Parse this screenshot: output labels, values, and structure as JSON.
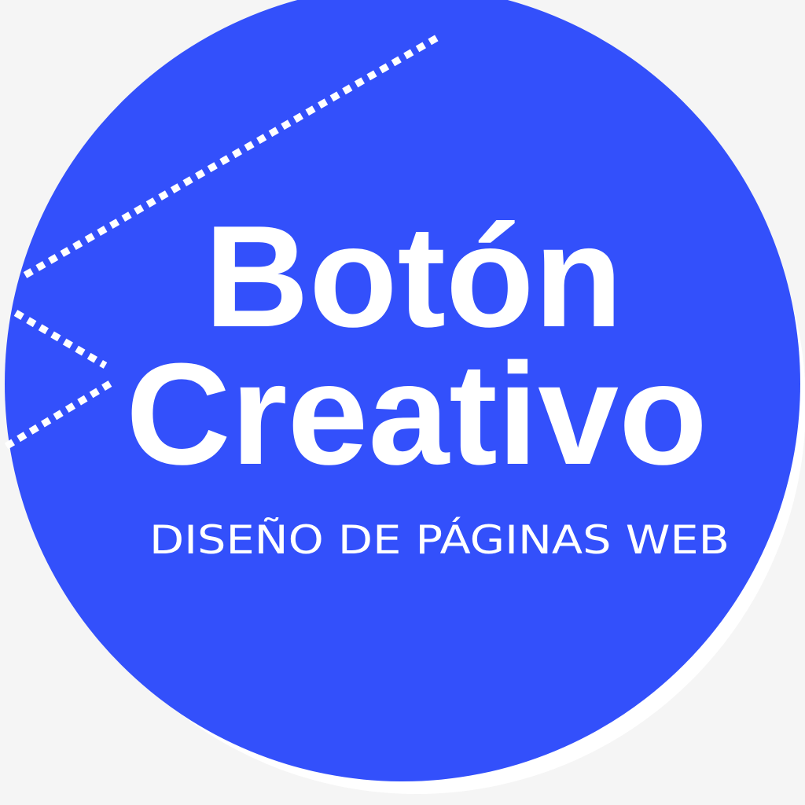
{
  "logo": {
    "title_line1": "Botón",
    "title_line2": "Creativo",
    "subtitle": "DISEÑO DE PÁGINAS WEB"
  },
  "colors": {
    "background": "#f5f5f5",
    "circle": "#3350fb",
    "shadow_disc": "#ffffff",
    "text": "#ffffff"
  }
}
